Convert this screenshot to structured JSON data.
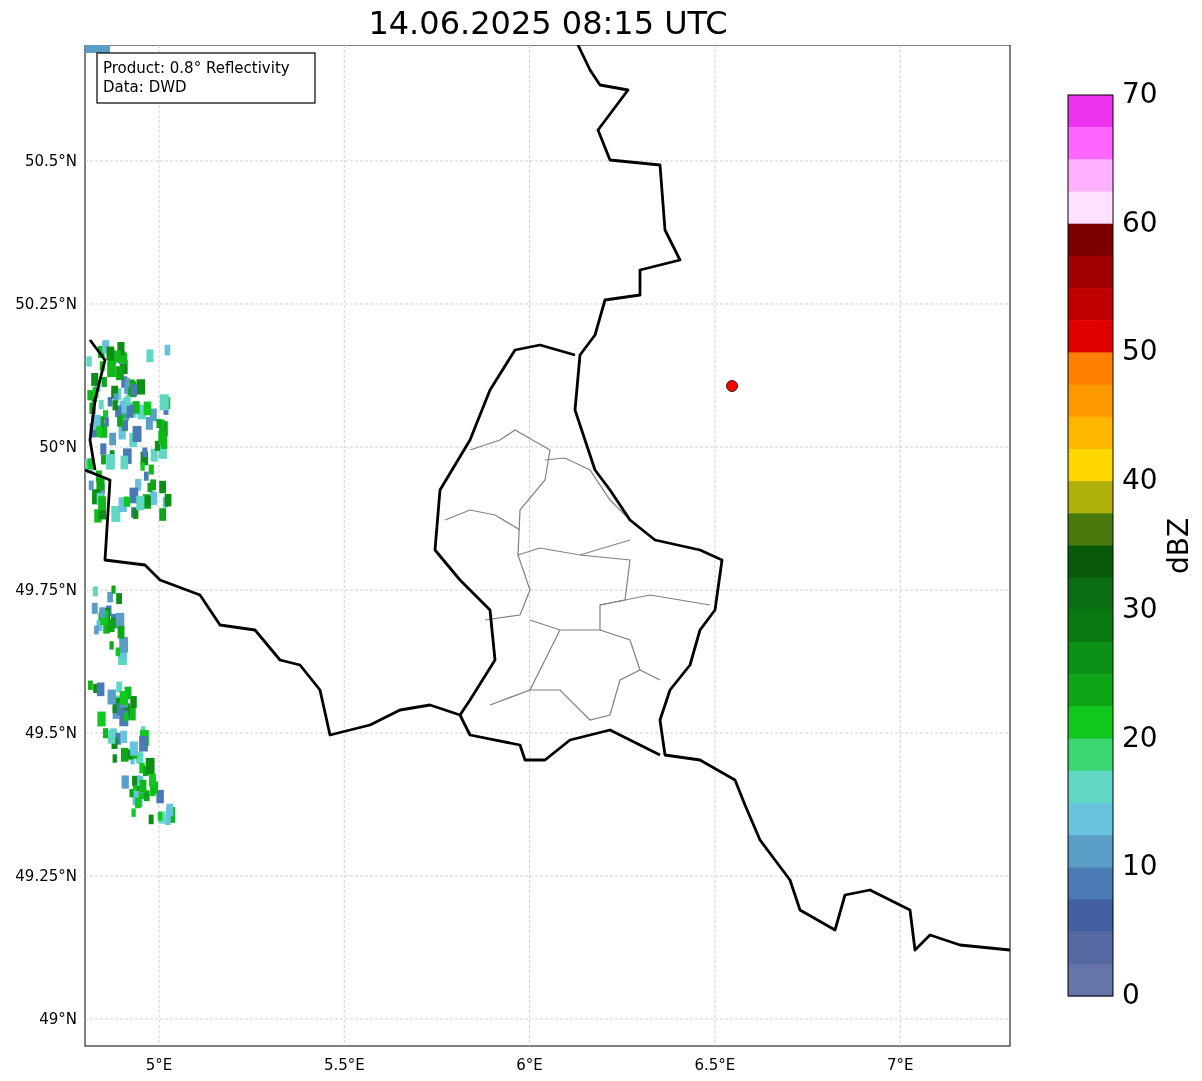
{
  "title": "14.06.2025 08:15 UTC",
  "info": [
    "Product: 0.8° Reflectivity",
    "Data: DWD"
  ],
  "map": {
    "yticks": [
      "50.5°N",
      "50.25°N",
      "50°N",
      "49.75°N",
      "49.5°N",
      "49.25°N",
      "49°N"
    ],
    "xticks": [
      "5°E",
      "5.5°E",
      "6°E",
      "6.5°E",
      "7°E"
    ]
  },
  "colorbar": {
    "label": "dBZ",
    "ticks": [
      "70",
      "60",
      "50",
      "40",
      "30",
      "20",
      "10",
      "0"
    ],
    "bins": [
      {
        "color": "#ee33ee"
      },
      {
        "color": "#ff66ff"
      },
      {
        "color": "#ffb0ff"
      },
      {
        "color": "#ffe0ff"
      },
      {
        "color": "#7a0000"
      },
      {
        "color": "#a00000"
      },
      {
        "color": "#c00000"
      },
      {
        "color": "#e00000"
      },
      {
        "color": "#ff7f00"
      },
      {
        "color": "#ff9900"
      },
      {
        "color": "#ffb700"
      },
      {
        "color": "#ffd700"
      },
      {
        "color": "#b0b00a"
      },
      {
        "color": "#4a7a0c"
      },
      {
        "color": "#0a5a0c"
      },
      {
        "color": "#0b6e12"
      },
      {
        "color": "#0a7b12"
      },
      {
        "color": "#0b8f14"
      },
      {
        "color": "#0ea617"
      },
      {
        "color": "#11c81e"
      },
      {
        "color": "#3cd672"
      },
      {
        "color": "#5fd7c2"
      },
      {
        "color": "#67c3dd"
      },
      {
        "color": "#5a9ec8"
      },
      {
        "color": "#4a7ab3"
      },
      {
        "color": "#4360a3"
      },
      {
        "color": "#5468a1"
      },
      {
        "color": "#6675a9"
      }
    ]
  }
}
